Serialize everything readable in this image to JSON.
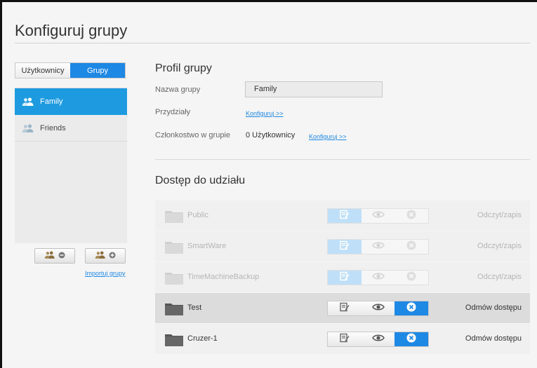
{
  "page": {
    "title": "Konfiguruj grupy"
  },
  "left": {
    "tabs": [
      {
        "label": "Użytkownicy",
        "active": false
      },
      {
        "label": "Grupy",
        "active": true
      }
    ],
    "groups": [
      {
        "label": "Family",
        "selected": true
      },
      {
        "label": "Friends",
        "selected": false
      }
    ],
    "import_link": "Importuj grupy"
  },
  "profile": {
    "title": "Profil grupy",
    "name_label": "Nazwa grupy",
    "name_value": "Family",
    "quota_label": "Przydziały",
    "quota_link": "Konfiguruj >>",
    "membership_label": "Członkostwo w grupie",
    "membership_value": "0 Użytkownicy",
    "membership_link": "Konfiguruj >>"
  },
  "shares": {
    "title": "Dostęp do udziału",
    "items": [
      {
        "name": "Public",
        "access": "read-write",
        "status": "Odczyt/zapis",
        "disabled": true
      },
      {
        "name": "SmartWare",
        "access": "read-write",
        "status": "Odczyt/zapis",
        "disabled": true
      },
      {
        "name": "TimeMachineBackup",
        "access": "read-write",
        "status": "Odczyt/zapis",
        "disabled": true
      },
      {
        "name": "Test",
        "access": "deny",
        "status": "Odmów dostępu",
        "disabled": false
      },
      {
        "name": "Cruzer-1",
        "access": "deny",
        "status": "Odmów dostępu",
        "disabled": false
      }
    ]
  },
  "colors": {
    "accent": "#1e88e5",
    "accent_light": "#a9d3f5",
    "disabled_text": "#b5b5b5"
  }
}
